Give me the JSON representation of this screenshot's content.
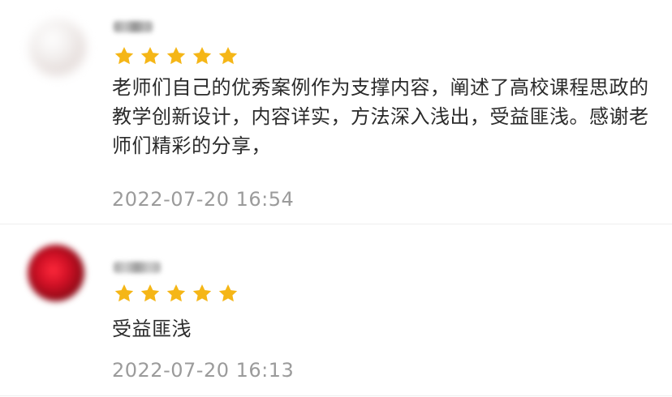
{
  "colors": {
    "star": "#f5b617",
    "comment_text": "#2b2b2b",
    "timestamp": "#9b9b9b",
    "divider": "#eeeeee"
  },
  "comments": [
    {
      "avatar": "avatar-icon",
      "rating": 5,
      "text": "老师们自己的优秀案例作为支撑内容，阐述了高校课程思政的教学创新设计，内容详实，方法深入浅出，受益匪浅。感谢老师们精彩的分享，",
      "time": "2022-07-20 16:54"
    },
    {
      "avatar": "avatar-icon",
      "rating": 5,
      "text": "受益匪浅",
      "time": "2022-07-20 16:13"
    }
  ]
}
